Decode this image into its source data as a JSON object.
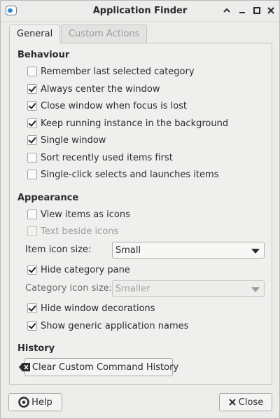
{
  "window": {
    "title": "Application Finder"
  },
  "tabs": [
    {
      "label": "General",
      "active": true
    },
    {
      "label": "Custom Actions",
      "active": false
    }
  ],
  "behaviour": {
    "heading": "Behaviour",
    "options": [
      {
        "label": "Remember last selected category",
        "checked": false
      },
      {
        "label": "Always center the window",
        "checked": true
      },
      {
        "label": "Close window when focus is lost",
        "checked": true
      },
      {
        "label": "Keep running instance in the background",
        "checked": true
      },
      {
        "label": "Single window",
        "checked": true
      },
      {
        "label": "Sort recently used items first",
        "checked": false
      },
      {
        "label": "Single-click selects and launches items",
        "checked": false
      }
    ]
  },
  "appearance": {
    "heading": "Appearance",
    "view_as_icons": {
      "label": "View items as icons",
      "checked": false
    },
    "text_beside_icons": {
      "label": "Text beside icons",
      "checked": false,
      "disabled": true
    },
    "item_icon_size": {
      "label": "Item icon size:",
      "value": "Small"
    },
    "hide_category_pane": {
      "label": "Hide category pane",
      "checked": true
    },
    "category_icon_size": {
      "label": "Category icon size:",
      "value": "Smaller",
      "disabled": true
    },
    "hide_decorations": {
      "label": "Hide window decorations",
      "checked": true
    },
    "generic_names": {
      "label": "Show generic application names",
      "checked": true
    }
  },
  "history": {
    "heading": "History",
    "clear_button": "Clear Custom Command History"
  },
  "footer": {
    "help_button": "Help",
    "close_button": "Close"
  },
  "colors": {
    "accent": "#2f88d8",
    "window_bg": "#ececeb"
  }
}
